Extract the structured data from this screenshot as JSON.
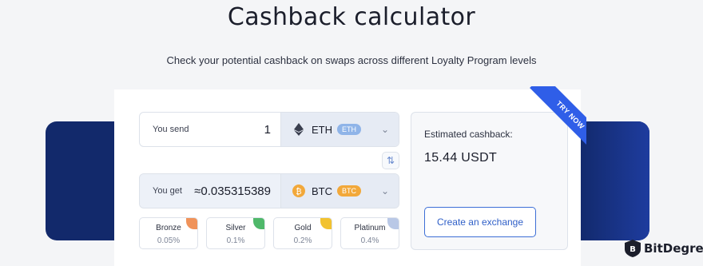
{
  "header": {
    "title": "Cashback calculator",
    "subtitle": "Check your potential cashback on swaps across different Loyalty Program levels"
  },
  "send": {
    "label": "You send",
    "value": "1",
    "currency": "ETH",
    "badge": "ETH",
    "icon": "ethereum-icon"
  },
  "get": {
    "label": "You get",
    "value": "≈0.035315389",
    "currency": "BTC",
    "badge": "BTC",
    "icon": "bitcoin-icon"
  },
  "levels": [
    {
      "name": "Bronze",
      "pct": "0.05%",
      "color": "#f0935a"
    },
    {
      "name": "Silver",
      "pct": "0.1%",
      "color": "#4fb86a"
    },
    {
      "name": "Gold",
      "pct": "0.2%",
      "color": "#f2c230"
    },
    {
      "name": "Platinum",
      "pct": "0.4%",
      "color": "#b9c8e6"
    }
  ],
  "estimate": {
    "label": "Estimated cashback:",
    "amount": "15.44 USDT",
    "button": "Create an exchange"
  },
  "ribbon": "TRY NOW",
  "brand": "BitDegree",
  "colors": {
    "accent": "#2f5ee8",
    "band": "#12296b"
  }
}
